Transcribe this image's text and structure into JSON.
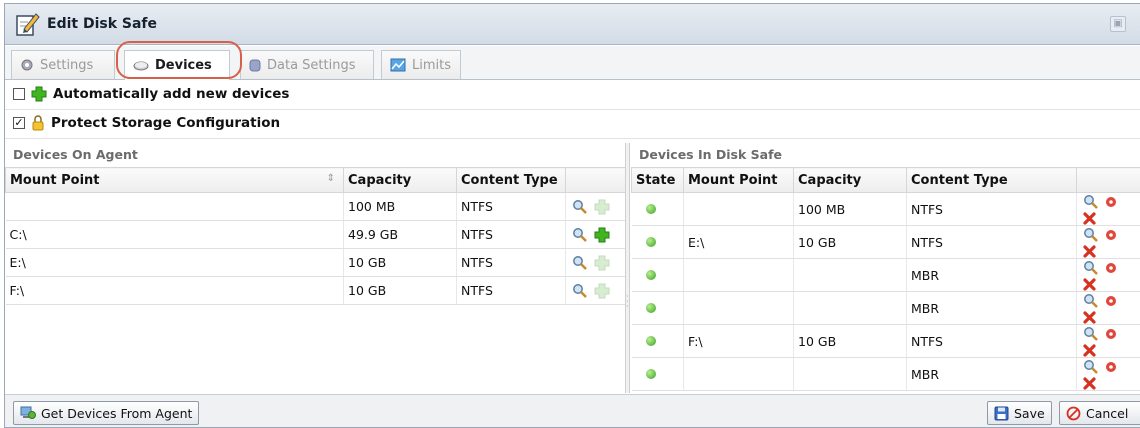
{
  "window": {
    "title": "Edit Disk Safe"
  },
  "tabs": [
    {
      "label": "Settings",
      "icon": "gear-icon"
    },
    {
      "label": "Devices",
      "icon": "disk-icon"
    },
    {
      "label": "Data Settings",
      "icon": "database-icon"
    },
    {
      "label": "Limits",
      "icon": "chart-icon"
    }
  ],
  "active_tab": "Devices",
  "options": {
    "auto_add": {
      "label": "Automatically add new devices",
      "checked": false
    },
    "protect": {
      "label": "Protect Storage Configuration",
      "checked": true
    }
  },
  "agent_panel": {
    "title": "Devices On Agent",
    "columns": [
      "Mount Point",
      "Capacity",
      "Content Type"
    ],
    "rows": [
      {
        "mount": "",
        "capacity": "100 MB",
        "type": "NTFS",
        "add_enabled": false
      },
      {
        "mount": "C:\\",
        "capacity": "49.9 GB",
        "type": "NTFS",
        "add_enabled": true
      },
      {
        "mount": "E:\\",
        "capacity": "10 GB",
        "type": "NTFS",
        "add_enabled": false
      },
      {
        "mount": "F:\\",
        "capacity": "10 GB",
        "type": "NTFS",
        "add_enabled": false
      }
    ]
  },
  "safe_panel": {
    "title": "Devices In Disk Safe",
    "columns": [
      "State",
      "Mount Point",
      "Capacity",
      "Content Type"
    ],
    "rows": [
      {
        "mount": "",
        "capacity": "100 MB",
        "type": "NTFS"
      },
      {
        "mount": "E:\\",
        "capacity": "10 GB",
        "type": "NTFS"
      },
      {
        "mount": "",
        "capacity": "",
        "type": "MBR"
      },
      {
        "mount": "",
        "capacity": "",
        "type": "MBR"
      },
      {
        "mount": "F:\\",
        "capacity": "10 GB",
        "type": "NTFS"
      },
      {
        "mount": "",
        "capacity": "",
        "type": "MBR"
      }
    ]
  },
  "buttons": {
    "get_devices": "Get Devices From Agent",
    "save": "Save",
    "cancel": "Cancel"
  },
  "colors": {
    "accent_highlight": "#d7604b",
    "state_green": "#3a9f22",
    "delete_red": "#d9301f"
  }
}
